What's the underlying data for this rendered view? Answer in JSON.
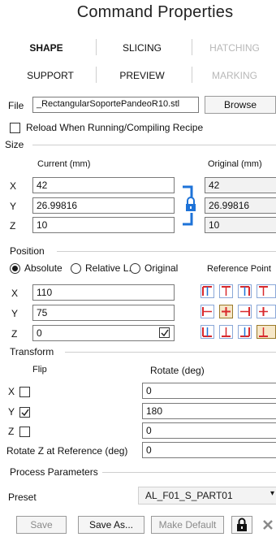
{
  "title": "Command Properties",
  "tabs": [
    {
      "label": "SHAPE",
      "state": "active"
    },
    {
      "label": "SLICING",
      "state": "normal"
    },
    {
      "label": "HATCHING",
      "state": "disabled"
    },
    {
      "label": "SUPPORT",
      "state": "normal"
    },
    {
      "label": "PREVIEW",
      "state": "normal"
    },
    {
      "label": "MARKING",
      "state": "disabled"
    }
  ],
  "file": {
    "label": "File",
    "value": "_RectangularSoportePandeoR10.stl",
    "browse_label": "Browse"
  },
  "reload": {
    "label": "Reload When Running/Compiling Recipe",
    "checked": false
  },
  "size": {
    "header": "Size",
    "current_label": "Current (mm)",
    "original_label": "Original (mm)",
    "rows": [
      {
        "axis": "X",
        "current": "42",
        "original": "42"
      },
      {
        "axis": "Y",
        "current": "26.99816",
        "original": "26.99816"
      },
      {
        "axis": "Z",
        "current": "10",
        "original": "10"
      }
    ],
    "lock_icon": "lock-icon"
  },
  "position": {
    "header": "Position",
    "modes": [
      {
        "label": "Absolute",
        "selected": true
      },
      {
        "label": "Relative L.▾",
        "selected": false
      },
      {
        "label": "Original",
        "selected": false
      }
    ],
    "reference_label": "Reference Point",
    "rows": [
      {
        "axis": "X",
        "value": "110"
      },
      {
        "axis": "Y",
        "value": "75"
      },
      {
        "axis": "Z",
        "value": "0"
      }
    ],
    "z_checked": true
  },
  "transform": {
    "header": "Transform",
    "flip_label": "Flip",
    "rotate_label": "Rotate (deg)",
    "rows": [
      {
        "axis": "X",
        "flip": false,
        "rotate": "0"
      },
      {
        "axis": "Y",
        "flip": true,
        "rotate": "180"
      },
      {
        "axis": "Z",
        "flip": false,
        "rotate": "0"
      }
    ],
    "rotate_ref_label": "Rotate Z at Reference (deg)",
    "rotate_ref_value": "0"
  },
  "process": {
    "header": "Process Parameters",
    "preset_label": "Preset",
    "preset_value": "AL_F01_S_PART01"
  },
  "footer": {
    "save": "Save",
    "save_as": "Save As...",
    "make_default": "Make Default"
  },
  "colors": {
    "accent": "#1e73d8",
    "ref_red": "#d8282c",
    "ref_selected_bg": "#f6e7c8"
  }
}
